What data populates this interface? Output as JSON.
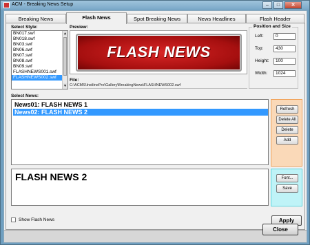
{
  "window": {
    "title": "ACM - Breaking News Setup",
    "buttons": {
      "minimize": "–",
      "maximize": "□",
      "close": "✕"
    }
  },
  "tabs": [
    {
      "label": "Breaking News",
      "active": false
    },
    {
      "label": "Flash News",
      "active": true
    },
    {
      "label": "Spot Breaking News",
      "active": false
    },
    {
      "label": "News Headlines",
      "active": false
    },
    {
      "label": "Flash Header",
      "active": false
    }
  ],
  "style_select": {
    "label": "Select Style:",
    "items": [
      "BN017.swf",
      "BN018.swf",
      "BN03.swf",
      "BN06.swf",
      "BN07.swf",
      "BN08.swf",
      "BN09.swf",
      "FLASHNEWS001.swf",
      "FLASHNEWS002.swf"
    ],
    "selected": "FLASHNEWS002.swf"
  },
  "preview": {
    "label": "Preview:",
    "banner_text": "FLASH NEWS",
    "colors": {
      "banner_red": "#c41a1a"
    }
  },
  "file": {
    "label": "File:",
    "path": "C:\\ACMS\\InstlinePro\\Gallery\\BreakingNews\\FLASHNEWS002.swf"
  },
  "position_size": {
    "title": "Position and Size",
    "left_label": "Left:",
    "left_value": "0",
    "top_label": "Top:",
    "top_value": "430",
    "height_label": "Height:",
    "height_value": "100",
    "width_label": "Width:",
    "width_value": "1024"
  },
  "news": {
    "label": "Select News:",
    "items": [
      "News01: FLASH NEWS 1",
      "News02: FLASH NEWS 2"
    ],
    "selected_index": 1
  },
  "news_buttons": {
    "refresh": "Refresh",
    "delete_all": "Delete All",
    "delete": "Delete",
    "add": "Add"
  },
  "editor": {
    "text": "FLASH NEWS 2"
  },
  "editor_buttons": {
    "font": "Font...",
    "save": "Save"
  },
  "show_flash_news": {
    "label": "Show Flash News",
    "checked": false
  },
  "apply_label": "Apply",
  "close_label": "Close",
  "colors": {
    "selection": "#3399ff",
    "orange_panel": "#fad9b8",
    "cyan_panel": "#bff3f7"
  }
}
